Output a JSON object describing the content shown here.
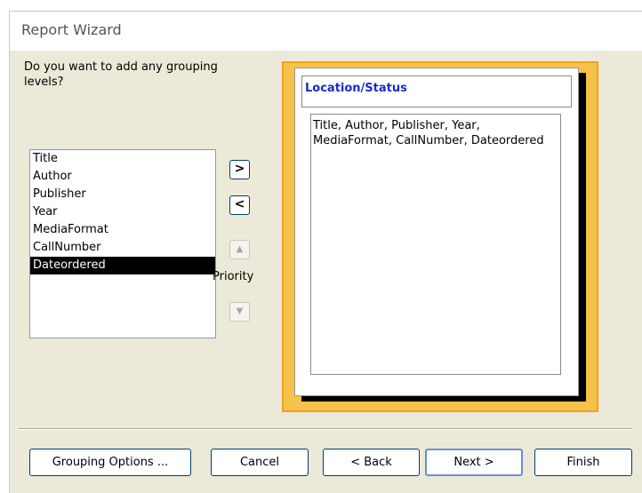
{
  "window": {
    "title": "Report Wizard"
  },
  "prompt": {
    "question": "Do you want to add any grouping levels?"
  },
  "fields": {
    "items": [
      "Title",
      "Author",
      "Publisher",
      "Year",
      "MediaFormat",
      "CallNumber",
      "Dateordered"
    ],
    "selected": "Dateordered"
  },
  "controls": {
    "add_label": ">",
    "remove_label": "<",
    "priority_up_icon": "up-triangle",
    "priority_down_icon": "down-triangle",
    "priority_label": "Priority"
  },
  "preview": {
    "group_header": "Location/Status",
    "detail_fields": "Title, Author, Publisher, Year, MediaFormat, CallNumber, Dateordered",
    "frame_color": "#f6c24a",
    "group_header_color": "#1a2bc8"
  },
  "buttons": {
    "grouping_options": "Grouping Options ...",
    "cancel": "Cancel",
    "back": "< Back",
    "next": "Next >",
    "finish": "Finish"
  }
}
